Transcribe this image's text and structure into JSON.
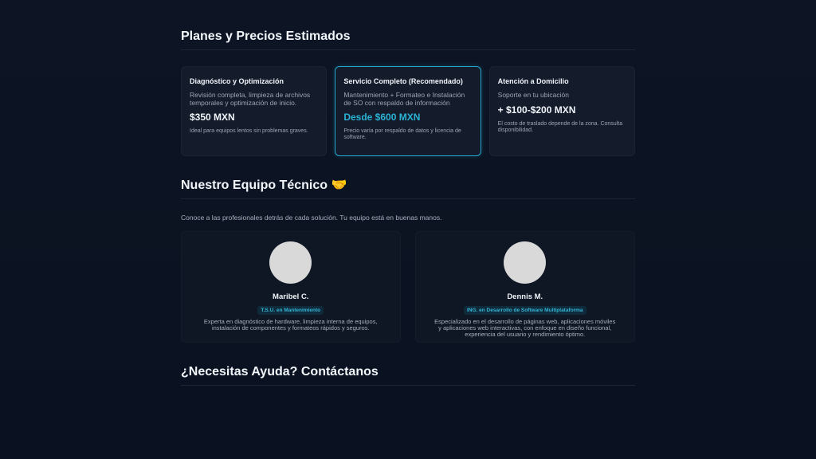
{
  "pricing": {
    "title": "Planes y Precios Estimados",
    "plans": [
      {
        "title": "Diagnóstico y Optimización",
        "desc": "Revisión completa, limpieza de archivos temporales y optimización de inicio.",
        "price": "$350 MXN",
        "note": "Ideal para equipos lentos sin problemas graves."
      },
      {
        "title": "Servicio Completo (Recomendado)",
        "desc": "Mantenimiento + Formateo e Instalación de SO con respaldo de información",
        "price": "Desde $600 MXN",
        "note": "Precio varía por respaldo de datos y licencia de software."
      },
      {
        "title": "Atención a Domicilio",
        "desc": "Soporte en tu ubicación",
        "price": "+ $100-$200 MXN",
        "note": "El costo de traslado depende de la zona. Consulta disponibilidad."
      }
    ]
  },
  "team": {
    "title": "Nuestro Equipo Técnico 🤝",
    "intro": "Conoce a las profesionales detrás de cada solución. Tu equipo está en buenas manos.",
    "members": [
      {
        "name": "Maribel C.",
        "role": "T.S.U. en Mantenimiento",
        "bio": "Experta en diagnóstico de hardware, limpieza interna de equipos, instalación de componentes y formateos rápidos y seguros."
      },
      {
        "name": "Dennis M.",
        "role": "ING. en Desarrollo de Software Multiplataforma",
        "bio": "Especializado en el desarrollo de páginas web, aplicaciones móviles y aplicaciones web interactivas, con enfoque en diseño funcional, experiencia del usuario y rendimiento óptimo."
      }
    ]
  },
  "contact": {
    "title": "¿Necesitas Ayuda? Contáctanos"
  },
  "colors": {
    "background": "#0b1220",
    "accent": "#22a9c9",
    "card": "#141c2c"
  }
}
